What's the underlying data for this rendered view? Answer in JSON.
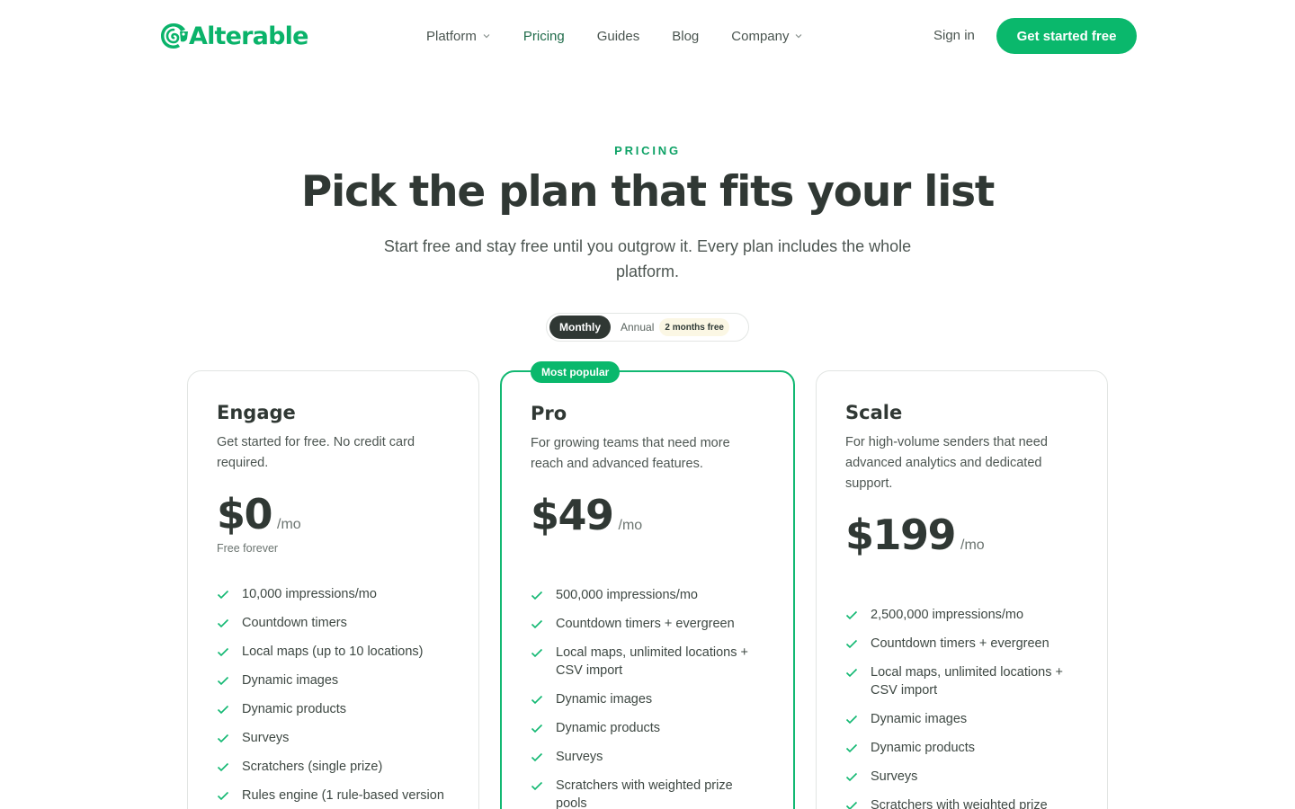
{
  "brand": {
    "name": "Alterable",
    "color": "#0ab36a",
    "logo_icon": "chameleon-icon"
  },
  "nav": {
    "items": [
      {
        "label": "Platform",
        "has_dropdown": true
      },
      {
        "label": "Pricing",
        "has_dropdown": false,
        "active": true
      },
      {
        "label": "Guides",
        "has_dropdown": false
      },
      {
        "label": "Blog",
        "has_dropdown": false
      },
      {
        "label": "Company",
        "has_dropdown": true
      }
    ],
    "sign_in": "Sign in",
    "cta": "Get started free"
  },
  "hero": {
    "eyebrow": "PRICING",
    "title": "Pick the plan that fits your list",
    "subtitle": "Start free and stay free until you outgrow it. Every plan includes the whole platform."
  },
  "billing_toggle": {
    "monthly": "Monthly",
    "annual": "Annual",
    "badge": "2 months free",
    "selected": "Monthly"
  },
  "plans": [
    {
      "name": "Engage",
      "description": "Get started for free. No credit card required.",
      "price": "$0",
      "period": "/mo",
      "note": "Free forever",
      "features": [
        "10,000 impressions/mo",
        "Countdown timers",
        "Local maps (up to 10 locations)",
        "Dynamic images",
        "Dynamic products",
        "Surveys",
        "Scratchers (single prize)",
        "Rules engine (1 rule-based version"
      ]
    },
    {
      "name": "Pro",
      "badge": "Most popular",
      "description": "For growing teams that need more reach and advanced features.",
      "price": "$49",
      "period": "/mo",
      "features": [
        "500,000 impressions/mo",
        "Countdown timers + evergreen",
        "Local maps, unlimited locations + CSV import",
        "Dynamic images",
        "Dynamic products",
        "Surveys",
        "Scratchers with weighted prize pools"
      ]
    },
    {
      "name": "Scale",
      "description": "For high-volume senders that need advanced analytics and dedicated support.",
      "price": "$199",
      "period": "/mo",
      "features": [
        "2,500,000 impressions/mo",
        "Countdown timers + evergreen",
        "Local maps, unlimited locations + CSV import",
        "Dynamic images",
        "Dynamic products",
        "Surveys",
        "Scratchers with weighted prize"
      ]
    }
  ],
  "colors": {
    "accent": "#0ab86c",
    "text": "#303834",
    "featured_border": "#12b872"
  }
}
